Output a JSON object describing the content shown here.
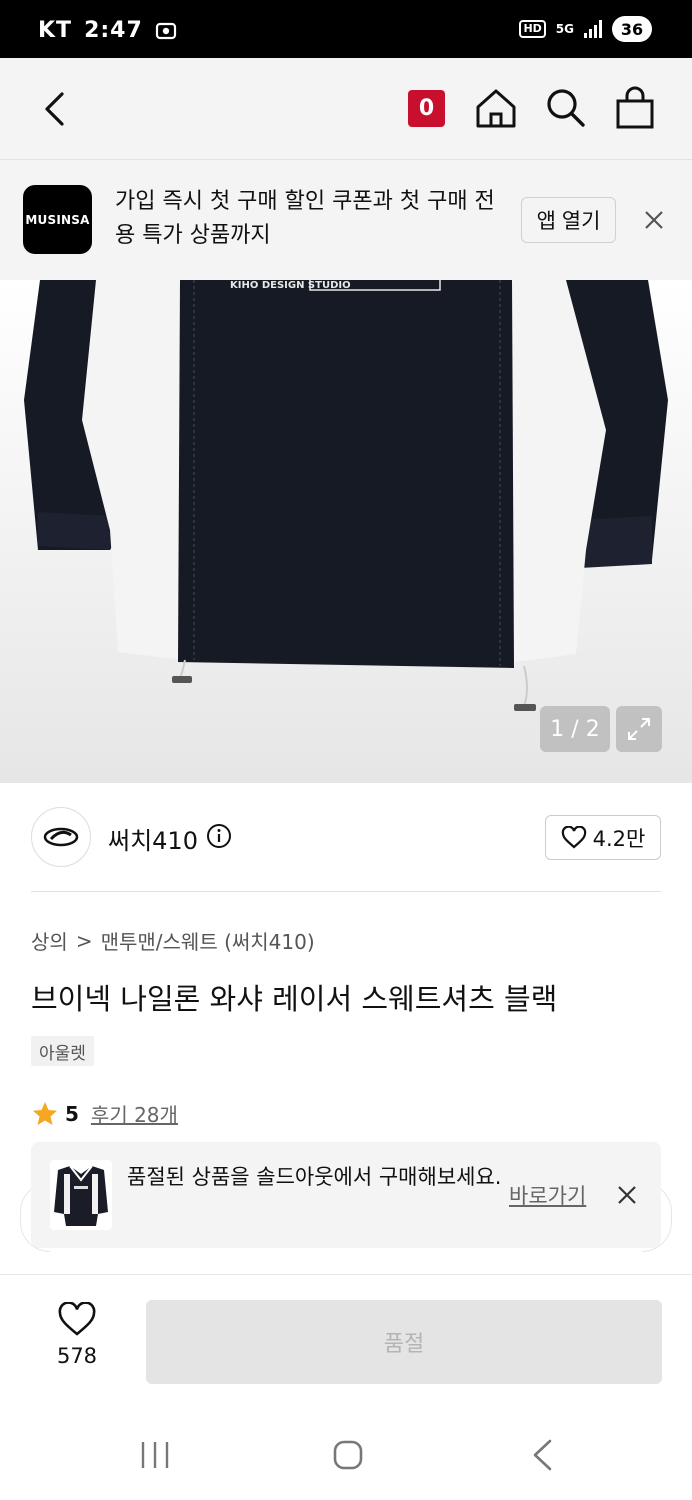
{
  "status_bar": {
    "carrier": "KT",
    "time": "2:47",
    "network_hd": "HD",
    "network_5g": "5G",
    "battery": "36"
  },
  "header": {
    "cart_count": "0",
    "icons": [
      "back-icon",
      "home-icon",
      "search-icon",
      "shopping-bag-icon"
    ]
  },
  "promo_banner": {
    "logo_text": "MUSINSA",
    "message": "가입 즉시 첫 구매 할인 쿠폰과 첫 구매 전용 특가 상품까지",
    "open_app_label": "앱 열기"
  },
  "gallery": {
    "counter": "1 / 2",
    "print_text": "KIHO DESIGN STUDIO"
  },
  "brand": {
    "name": "써치410",
    "like_count": "4.2만"
  },
  "product": {
    "breadcrumb_category": "상의",
    "breadcrumb_separator": ">",
    "breadcrumb_sub": "맨투맨/스웨트 (써치410)",
    "title": "브이넥 나일론 와샤 레이서 스웨트셔츠 블랙",
    "tag": "아울렛",
    "rating_score": "5",
    "review_label": "후기 28개"
  },
  "soldout_toast": {
    "message": "품절된 상품을 솔드아웃에서 구매해보세요.",
    "link_label": "바로가기"
  },
  "bottom_bar": {
    "wish_count": "578",
    "buy_label": "품절"
  },
  "colors": {
    "brand_red": "#c8102e",
    "star": "#f5a623"
  }
}
